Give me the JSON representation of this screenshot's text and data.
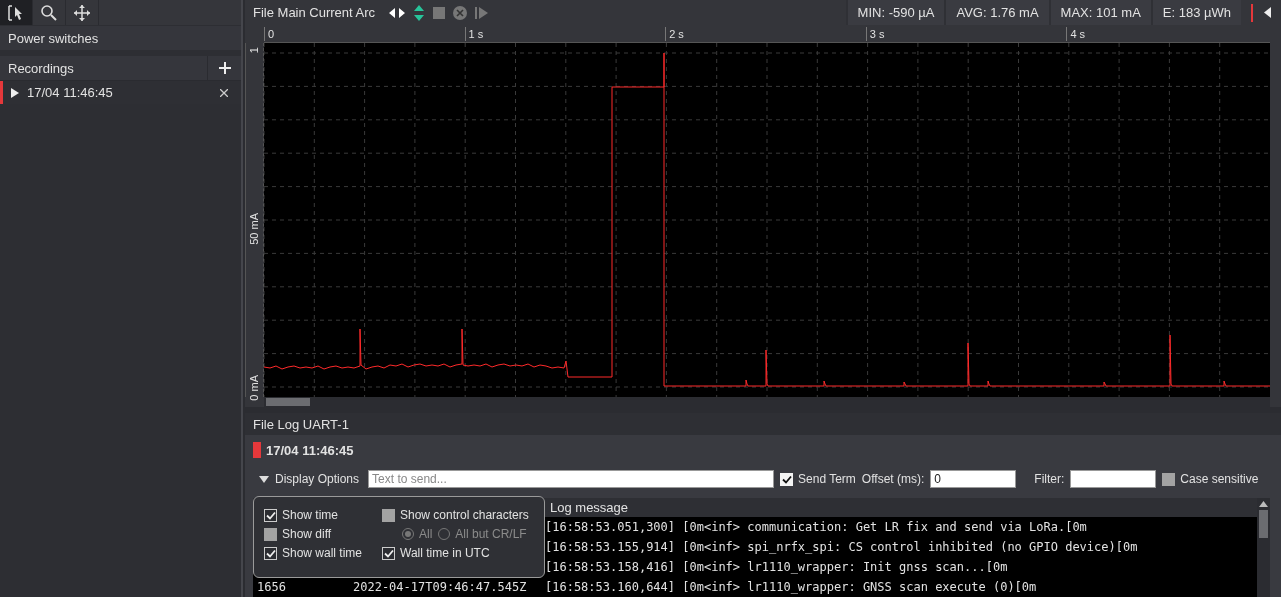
{
  "toolbar": {
    "tools": [
      {
        "selected": true
      },
      {
        "selected": false
      },
      {
        "selected": false
      }
    ]
  },
  "sidebar": {
    "power_switches": "Power switches",
    "recordings": {
      "title": "Recordings",
      "items": [
        {
          "label": "17/04 11:46:45",
          "expanded": false,
          "color": "#e5383b"
        }
      ]
    }
  },
  "chart_panel": {
    "title": "File Main Current Arc",
    "stats": [
      "MIN: -590 µA",
      "AVG: 1.76 mA",
      "MAX: 101 mA",
      "E: 183 µWh"
    ],
    "x_axis_labels": [
      "0",
      "1 s",
      "2 s",
      "3 s",
      "4 s"
    ],
    "y_axis_labels": [
      "1",
      "50 mA",
      "0 mA"
    ]
  },
  "log_panel": {
    "title": "File Log UART-1",
    "recording": {
      "label": "17/04 11:46:45",
      "color": "#e5383b"
    },
    "display_options": {
      "label": "Display Options",
      "expanded": true,
      "options": [
        {
          "kind": "checkbox",
          "label": "Show time",
          "checked": true,
          "disabled": false
        },
        {
          "kind": "checkbox",
          "label": "Show control characters",
          "checked": false,
          "disabled": false
        },
        {
          "kind": "checkbox",
          "label": "Show diff",
          "checked": false,
          "disabled": false
        },
        {
          "kind": "radio_group",
          "choices": [
            {
              "label": "All",
              "selected": true,
              "disabled": true
            },
            {
              "label": "All but CR/LF",
              "selected": false,
              "disabled": true
            }
          ]
        },
        {
          "kind": "checkbox",
          "label": "Show wall time",
          "checked": true,
          "disabled": false
        },
        {
          "kind": "checkbox",
          "label": "Wall time in UTC",
          "checked": true,
          "disabled": false
        }
      ]
    },
    "send_field": {
      "placeholder": "Text to send..."
    },
    "send_term": {
      "label": "Send Term",
      "checked": true
    },
    "offset": {
      "label": "Offset (ms):",
      "value": "0"
    },
    "filter": {
      "label": "Filter:"
    },
    "case_sensitive": {
      "label": "Case sensitive",
      "checked": false
    },
    "table": {
      "columns": [
        "Log message"
      ],
      "rows": [
        {
          "message": "[16:58:53.051,300] [0m<inf> communication: Get LR fix and send via LoRa.[0m"
        },
        {
          "message": "[16:58:53.155,914] [0m<inf> spi_nrfx_spi: CS control inhibited (no GPIO device)[0m"
        },
        {
          "message": "[16:58:53.158,416] [0m<inf> lr1110_wrapper: Init gnss scan...[0m"
        },
        {
          "index": "1656",
          "time": "2022-04-17T09:46:47.545Z",
          "message": "[16:58:53.160,644] [0m<inf> lr1110_wrapper: GNSS scan execute (0)[0m"
        }
      ]
    }
  }
}
